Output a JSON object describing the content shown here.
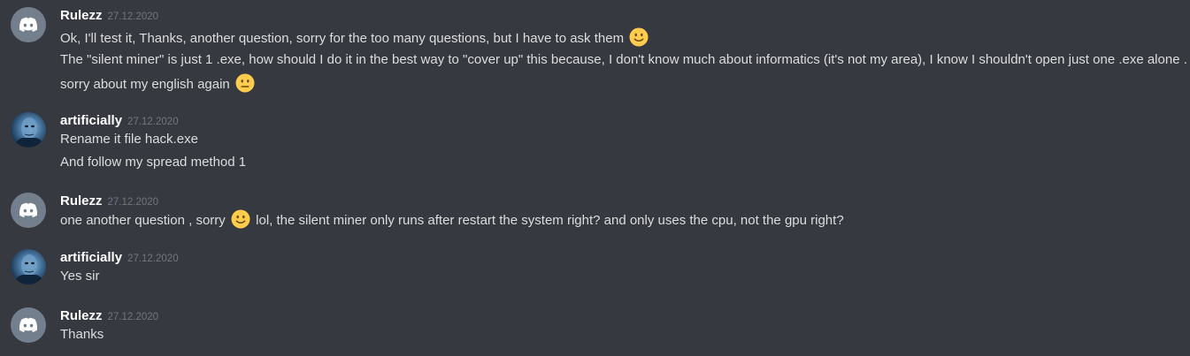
{
  "messages": [
    {
      "author": "Rulezz",
      "timestamp": "27.12.2020",
      "avatar": "discord-default-avatar",
      "lines": [
        {
          "text": "Ok, I'll test it, Thanks, another question, sorry for the too many questions, but I have to ask them",
          "emoji_after": "slightly-smiling-face"
        },
        {
          "text": "The \"silent miner\" is just 1 .exe, how should I do it in the best way to \"cover up\" this because, I don't know much about informatics (it's not my area), I know I shouldn't open just one .exe alone ."
        },
        {
          "text": "sorry about my english again",
          "emoji_after": "neutral-face"
        }
      ]
    },
    {
      "author": "artificially",
      "timestamp": "27.12.2020",
      "avatar": "photo-avatar",
      "lines": [
        {
          "text": "Rename it file hack.exe"
        },
        {
          "text": "And follow my spread method 1"
        }
      ]
    },
    {
      "author": "Rulezz",
      "timestamp": "27.12.2020",
      "avatar": "discord-default-avatar",
      "lines": [
        {
          "text_before": "one another question , sorry",
          "emoji": "slightly-smiling-face",
          "text_after": "lol, the silent miner only runs after restart the system right? and only uses the cpu, not the gpu right?"
        }
      ]
    },
    {
      "author": "artificially",
      "timestamp": "27.12.2020",
      "avatar": "photo-avatar",
      "lines": [
        {
          "text": "Yes sir"
        }
      ]
    },
    {
      "author": "Rulezz",
      "timestamp": "27.12.2020",
      "avatar": "discord-default-avatar",
      "lines": [
        {
          "text": "Thanks"
        }
      ]
    }
  ],
  "colors": {
    "background": "#36393f",
    "username": "#ffffff",
    "timestamp": "#72767d",
    "message_text": "#dcddde",
    "default_avatar": "#747f8d",
    "emoji_yellow": "#ffcc4d"
  }
}
